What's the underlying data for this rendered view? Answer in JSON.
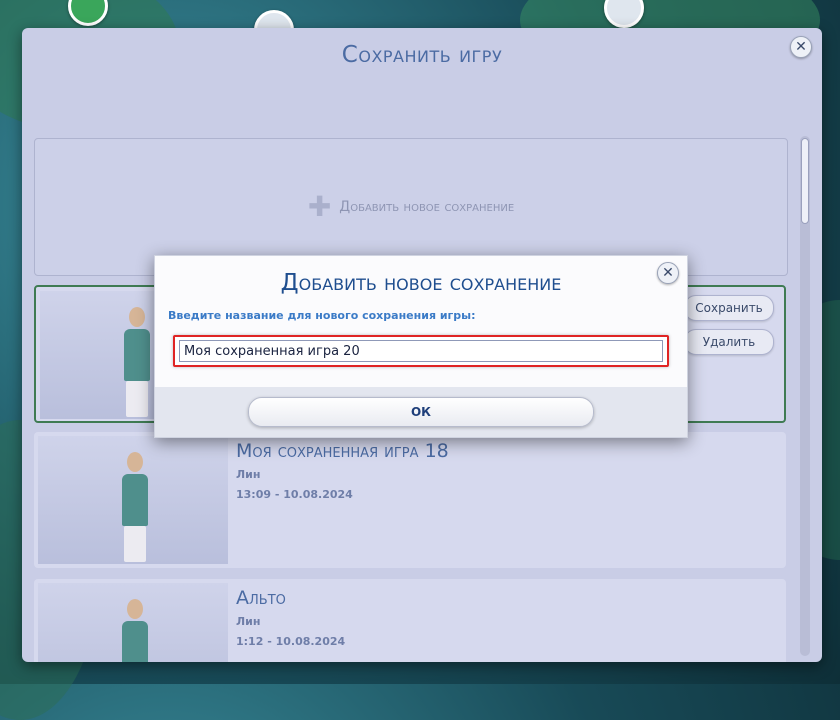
{
  "window": {
    "title": "Сохранить игру",
    "close_symbol": "✕"
  },
  "add_slot": {
    "plus_symbol": "✚",
    "label": "Добавить новое сохранение"
  },
  "slots": [
    {
      "name": "",
      "save_label": "Сохранить",
      "delete_label": "Удалить"
    },
    {
      "name": "Моя сохраненная игра 18",
      "household": "Лин",
      "time": "13:09 - 10.08.2024"
    },
    {
      "name": "Альто",
      "household": "Лин",
      "time": "1:12 - 10.08.2024"
    }
  ],
  "modal": {
    "title": "Добавить новое сохранение",
    "close_symbol": "✕",
    "label": "Введите название для нового сохранения игры:",
    "input_value": "Моя сохраненная игра 20",
    "ok_label": "ОК"
  },
  "colors": {
    "accent": "#4b6ba3",
    "highlight": "#e02424",
    "selected_border": "#3f7b53"
  }
}
